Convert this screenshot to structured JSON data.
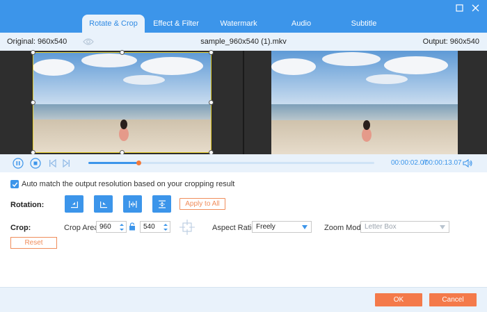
{
  "window": {
    "minimize_icon": "restore-icon",
    "close_icon": "close-icon"
  },
  "tabs": [
    {
      "label": "Rotate & Crop",
      "active": true
    },
    {
      "label": "Effect & Filter",
      "active": false
    },
    {
      "label": "Watermark",
      "active": false
    },
    {
      "label": "Audio",
      "active": false
    },
    {
      "label": "Subtitle",
      "active": false
    }
  ],
  "info": {
    "original": "Original: 960x540",
    "filename": "sample_960x540 (1).mkv",
    "output": "Output: 960x540"
  },
  "playback": {
    "current_time": "00:00:02.07",
    "total_time": "/00:00:13.07",
    "progress": 0.175
  },
  "settings": {
    "auto_match_label": "Auto match the output resolution based on your cropping result",
    "auto_match_checked": true,
    "rotation_label": "Rotation:",
    "apply_all_label": "Apply to All",
    "crop_label": "Crop:",
    "crop_area_label": "Crop Area:",
    "crop_width": "960",
    "crop_height": "540",
    "aspect_ratio_label": "Aspect Ratio:",
    "aspect_ratio_value": "Freely",
    "zoom_mode_label": "Zoom Mode:",
    "zoom_mode_value": "Letter Box",
    "reset_label": "Reset"
  },
  "footer": {
    "ok_label": "OK",
    "cancel_label": "Cancel"
  },
  "colors": {
    "accent": "#3c95ea",
    "orange": "#f47a4a",
    "crop_frame": "#e6cf2d"
  }
}
